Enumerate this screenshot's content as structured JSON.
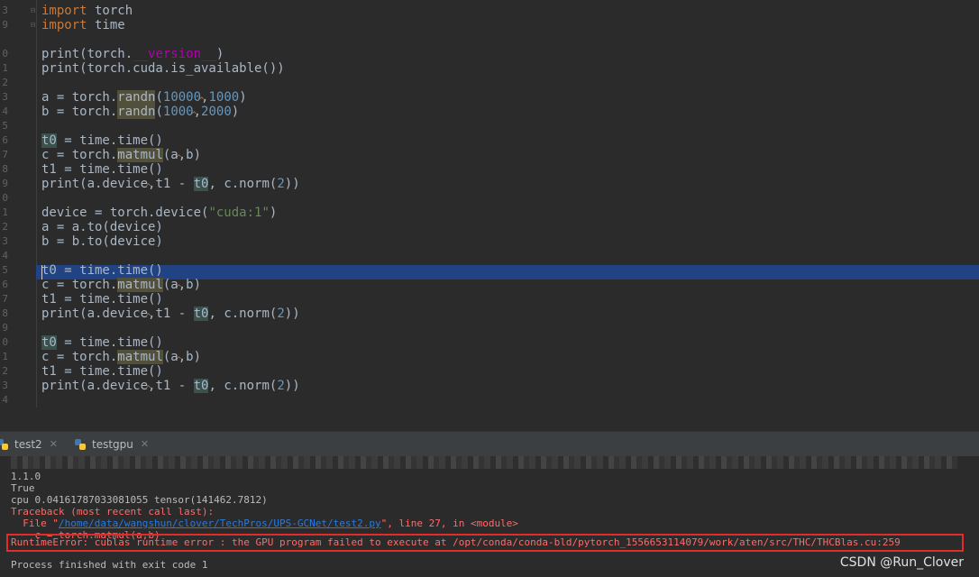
{
  "editor": {
    "line_numbers": [
      "3",
      "9",
      "0",
      "1",
      "2",
      "3",
      "4",
      "5",
      "6",
      "7",
      "8",
      "9",
      "0",
      "1",
      "2",
      "3",
      "4",
      "5",
      "6",
      "7",
      "8",
      "9",
      "0",
      "1",
      "2",
      "3",
      "4"
    ],
    "code": {
      "l1_kw": "import",
      "l1_rest": " torch",
      "l2_kw": "import",
      "l2_rest": " time",
      "l4a": "print(torch.",
      "l4b": "__version__",
      "l4c": ")",
      "l5": "print(torch.cuda.is_available())",
      "l7a": "a = torch.",
      "l7fn": "randn",
      "l7b": "(",
      "l7n1": "10000",
      "l7sep": ",",
      "l7n2": "1000",
      "l7c": ")",
      "l8a": "b = torch.",
      "l8fn": "randn",
      "l8b": "(",
      "l8n1": "1000",
      "l8sep": ",",
      "l8n2": "2000",
      "l8c": ")",
      "t0": "t0",
      "assign_time": " = time.time()",
      "c_a": "c = torch.",
      "matmul": "matmul",
      "paren_a": "(a",
      "comma": ",",
      "b_paren": "b)",
      "t1": "t1 = time.time()",
      "pr_a": "print(a.device",
      "pr_sep": ",",
      "pr_b": "t1 - ",
      "pr_t0": "t0",
      "pr_c": ", c.norm(",
      "pr_2": "2",
      "pr_d": "))",
      "l17a": "device = torch.device(",
      "l17str": "\"cuda:1\"",
      "l17b": ")",
      "l18": "a = a.to(device)",
      "l19": "b = b.to(device)"
    }
  },
  "run_panel": {
    "tabs": [
      {
        "label": "test2",
        "icon": "python-icon"
      },
      {
        "label": "testgpu",
        "icon": "python-icon"
      }
    ],
    "console": {
      "l1": "1.1.0",
      "l2": "True",
      "l3": "cpu 0.04161787033081055 tensor(141462.7812)",
      "l4": "Traceback (most recent call last):",
      "l5_a": "  File \"",
      "l5_link": "/home/data/wangshun/clover/TechPros/UPS-GCNet/test2.py",
      "l5_b": "\", line 27, in <module>",
      "l6": "    c = torch.matmul(a,b)",
      "l7": "RuntimeError: cublas runtime error : the GPU program failed to execute at /opt/conda/conda-bld/pytorch_1556653114079/work/aten/src/THC/THCBlas.cu:259",
      "l8": "Process finished with exit code 1"
    },
    "error_color": "#ff6b68",
    "highlight_box_color": "#e22b2b"
  },
  "watermark": "CSDN @Run_Clover"
}
